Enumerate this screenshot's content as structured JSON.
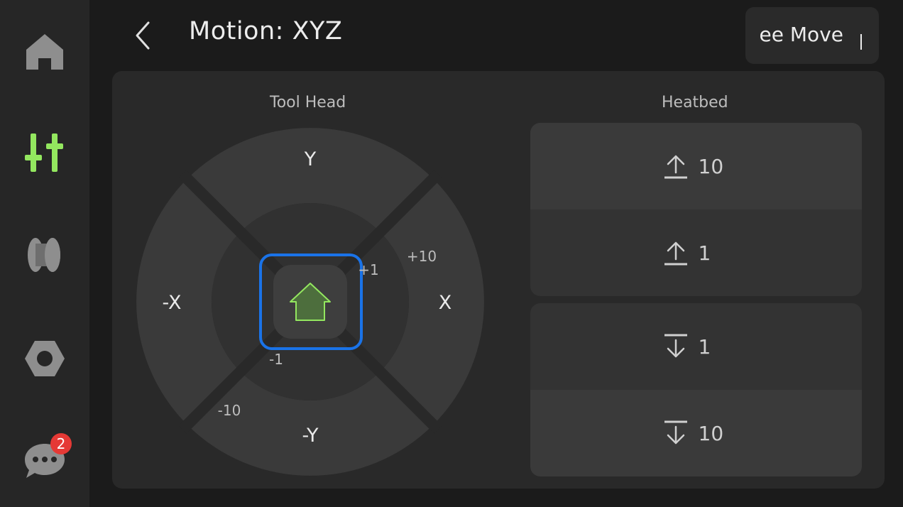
{
  "header": {
    "title": "Motion: XYZ",
    "mode_button_label": "ee Move"
  },
  "sidebar": {
    "items": [
      {
        "name": "home",
        "icon": "home-icon",
        "active": false
      },
      {
        "name": "controls",
        "icon": "sliders-icon",
        "active": true
      },
      {
        "name": "filament",
        "icon": "filament-spool-icon",
        "active": false
      },
      {
        "name": "settings",
        "icon": "nut-icon",
        "active": false
      },
      {
        "name": "messages",
        "icon": "chat-icon",
        "active": false,
        "badge": "2"
      }
    ]
  },
  "tool_head": {
    "label": "Tool Head",
    "y_label": "Y",
    "neg_y_label": "-Y",
    "x_label": "X",
    "neg_x_label": "-X",
    "step_plus_10": "+10",
    "step_plus_1": "+1",
    "step_minus_1": "-1",
    "step_minus_10": "-10",
    "home_icon": "home-icon"
  },
  "heatbed": {
    "label": "Heatbed",
    "buttons": [
      {
        "direction": "up",
        "value": "10"
      },
      {
        "direction": "up",
        "value": "1"
      },
      {
        "direction": "down",
        "value": "1"
      },
      {
        "direction": "down",
        "value": "10"
      }
    ]
  },
  "colors": {
    "accent_green": "#93e75f",
    "focus_blue": "#1a73e8",
    "badge_red": "#e53935"
  }
}
